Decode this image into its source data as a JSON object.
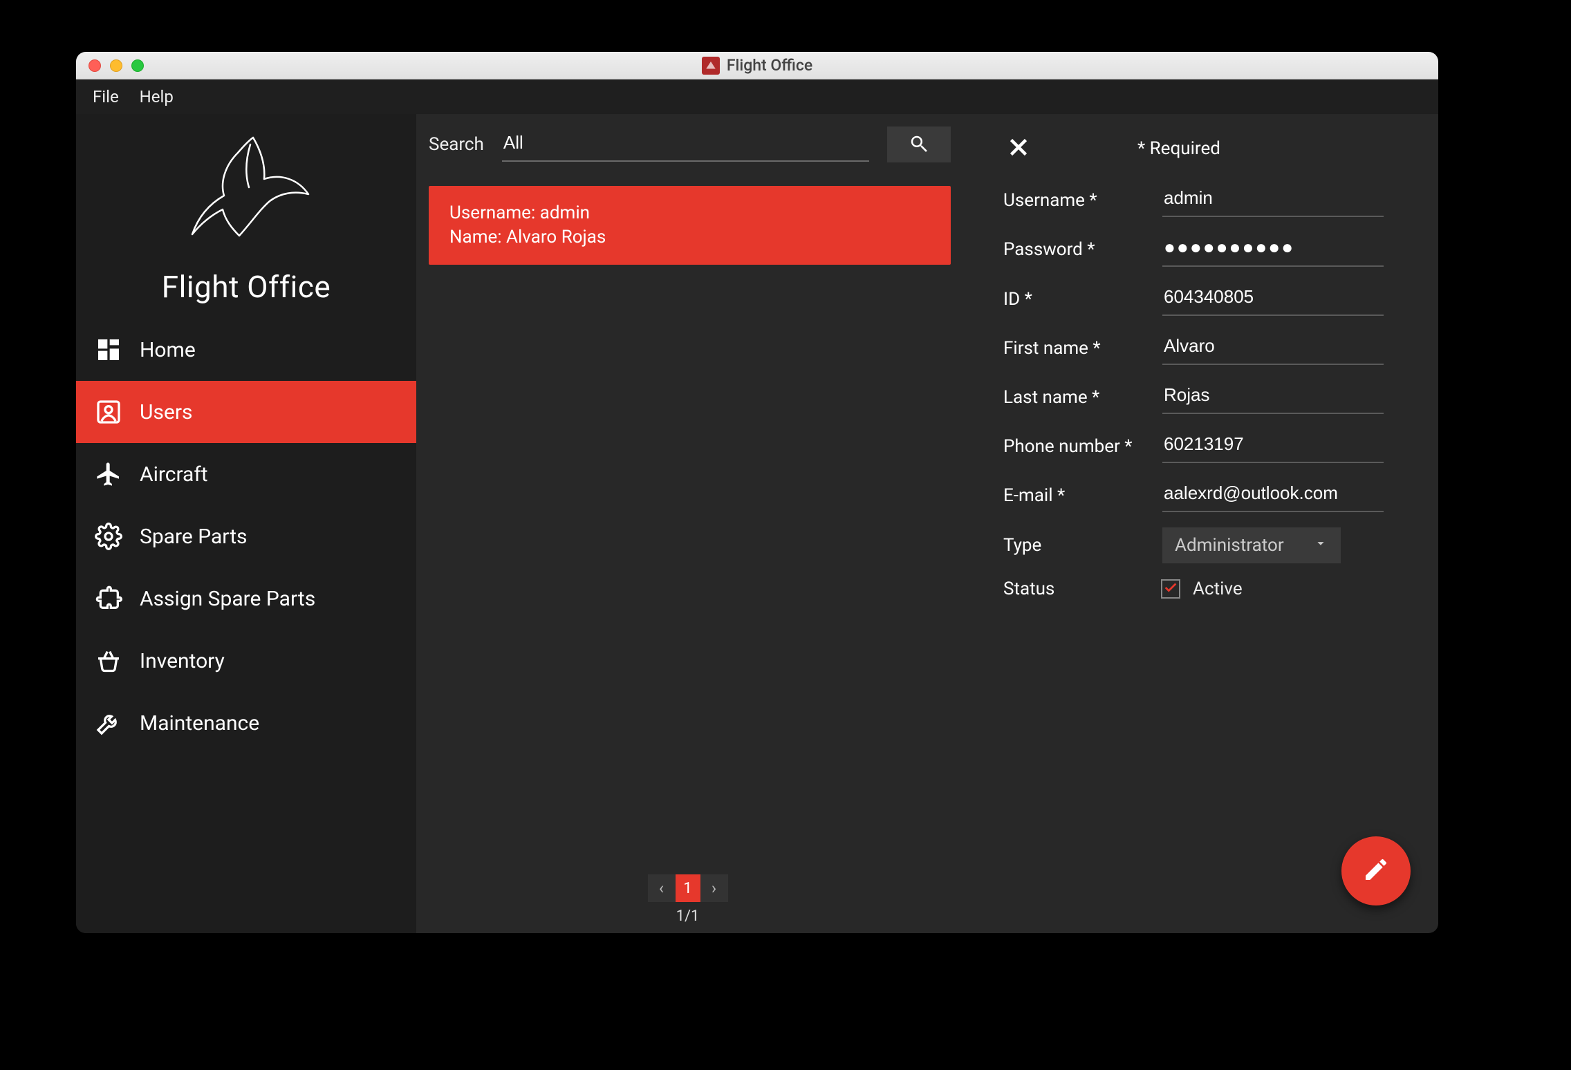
{
  "window": {
    "title": "Flight Office"
  },
  "menubar": {
    "file": "File",
    "help": "Help"
  },
  "brand": {
    "title": "Flight Office"
  },
  "sidebar": {
    "items": [
      {
        "label": "Home"
      },
      {
        "label": "Users"
      },
      {
        "label": "Aircraft"
      },
      {
        "label": "Spare Parts"
      },
      {
        "label": "Assign Spare Parts"
      },
      {
        "label": "Inventory"
      },
      {
        "label": "Maintenance"
      }
    ]
  },
  "search": {
    "label": "Search",
    "value": "All"
  },
  "list": {
    "items": [
      {
        "line1": "Username: admin",
        "line2": "Name: Alvaro Rojas"
      }
    ]
  },
  "pager": {
    "page": "1",
    "summary": "1/1"
  },
  "detail": {
    "required_note": "* Required",
    "fields": {
      "username_label": "Username *",
      "username_value": "admin",
      "password_label": "Password *",
      "password_value": "●●●●●●●●●●",
      "id_label": "ID *",
      "id_value": "604340805",
      "firstname_label": "First name *",
      "firstname_value": "Alvaro",
      "lastname_label": "Last name *",
      "lastname_value": "Rojas",
      "phone_label": "Phone number *",
      "phone_value": "60213197",
      "email_label": "E-mail *",
      "email_value": "aalexrd@outlook.com",
      "type_label": "Type",
      "type_value": "Administrator",
      "status_label": "Status",
      "status_value": "Active"
    }
  }
}
